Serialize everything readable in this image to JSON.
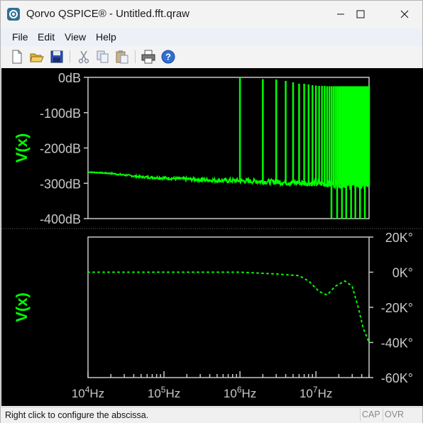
{
  "window": {
    "title": "Qorvo QSPICE® - Untitled.fft.qraw"
  },
  "menu": [
    "File",
    "Edit",
    "View",
    "Help"
  ],
  "toolbar": {
    "buttons": [
      "new-icon",
      "open-icon",
      "save-icon",
      "cut-icon",
      "copy-icon",
      "paste-icon",
      "print-icon",
      "help-icon"
    ]
  },
  "colors": {
    "trace": "#00ff00",
    "plot_background": "#000000",
    "frame": "#c8c8c8"
  },
  "x_axis": {
    "scale": "log",
    "range": [
      10000,
      50000000
    ],
    "tick_labels": [
      {
        "value": 10000,
        "mantissa": "10",
        "exp": "4",
        "unit": "Hz"
      },
      {
        "value": 100000,
        "mantissa": "10",
        "exp": "5",
        "unit": "Hz"
      },
      {
        "value": 1000000,
        "mantissa": "10",
        "exp": "6",
        "unit": "Hz"
      },
      {
        "value": 10000000,
        "mantissa": "10",
        "exp": "7",
        "unit": "Hz"
      }
    ]
  },
  "chart_data": [
    {
      "type": "line",
      "ylabel": "V(x)",
      "ylim": [
        -400,
        0
      ],
      "y_unit": "dB",
      "yticks": [
        {
          "value": 0,
          "label": "0dB"
        },
        {
          "value": -100,
          "label": "-100dB"
        },
        {
          "value": -200,
          "label": "-200dB"
        },
        {
          "value": -300,
          "label": "-300dB"
        },
        {
          "value": -400,
          "label": "-400dB"
        }
      ],
      "noise_floor": [
        [
          10000,
          -268
        ],
        [
          20000,
          -272
        ],
        [
          50000,
          -282
        ],
        [
          100000,
          -285
        ],
        [
          200000,
          -288
        ],
        [
          500000,
          -292
        ],
        [
          1000000,
          -293
        ],
        [
          2000000,
          -295
        ],
        [
          5000000,
          -298
        ],
        [
          10000000,
          -300
        ],
        [
          20000000,
          -303
        ],
        [
          50000000,
          -306
        ]
      ],
      "harmonic_spikes_hz": [
        1000000,
        2000000,
        3000000,
        4000000,
        5000000,
        6000000,
        7000000,
        8000000,
        9000000,
        10000000,
        11000000,
        12000000,
        13000000,
        14000000,
        15000000,
        16000000,
        17000000,
        18000000,
        19000000,
        20000000,
        21000000,
        22000000,
        23000000,
        24000000,
        25000000,
        26000000,
        27000000,
        28000000,
        29000000,
        30000000,
        31000000,
        32000000,
        33000000,
        34000000,
        35000000,
        36000000,
        37000000,
        38000000,
        39000000,
        40000000,
        41000000,
        42000000,
        43000000,
        44000000,
        45000000,
        46000000,
        47000000,
        48000000,
        49000000,
        50000000
      ],
      "harmonic_peak_db": [
        0,
        -5,
        -6,
        -10,
        -14,
        -18,
        -18,
        -20,
        -22,
        -23,
        -24,
        -24,
        -24,
        -25,
        -25,
        -25,
        -25,
        -25,
        -25,
        -25,
        -25,
        -25,
        -25,
        -25,
        -25,
        -25,
        -25,
        -25,
        -25,
        -25,
        -25,
        -25,
        -25,
        -25,
        -25,
        -25,
        -25,
        -25,
        -25,
        -25,
        -25,
        -25,
        -25,
        -25,
        -25,
        -25,
        -25,
        -25,
        -25,
        -25
      ],
      "dropout_spikes_hz": [
        16000000,
        19000000,
        22000000,
        25000000,
        29000000,
        33000000,
        38000000,
        44000000
      ]
    },
    {
      "type": "line",
      "ylabel": "V(x)",
      "ylim": [
        -60,
        20
      ],
      "y_unit": "K°",
      "style": "dotted",
      "yticks": [
        {
          "value": 20,
          "label": "20K°"
        },
        {
          "value": 0,
          "label": "0K°"
        },
        {
          "value": -20,
          "label": "-20K°"
        },
        {
          "value": -40,
          "label": "-40K°"
        },
        {
          "value": -60,
          "label": "-60K°"
        }
      ],
      "points": [
        [
          10000,
          0
        ],
        [
          50000,
          0
        ],
        [
          100000,
          0
        ],
        [
          500000,
          0
        ],
        [
          1000000,
          0
        ],
        [
          3000000,
          -1
        ],
        [
          6000000,
          -2
        ],
        [
          8000000,
          -5
        ],
        [
          11000000,
          -11
        ],
        [
          14000000,
          -13
        ],
        [
          18000000,
          -8
        ],
        [
          24000000,
          -5
        ],
        [
          30000000,
          -8
        ],
        [
          36000000,
          -20
        ],
        [
          42000000,
          -32
        ],
        [
          50000000,
          -40
        ]
      ]
    }
  ],
  "status": {
    "text": "Right click to configure the abscissa.",
    "indicators": [
      "CAP",
      "OVR"
    ]
  }
}
